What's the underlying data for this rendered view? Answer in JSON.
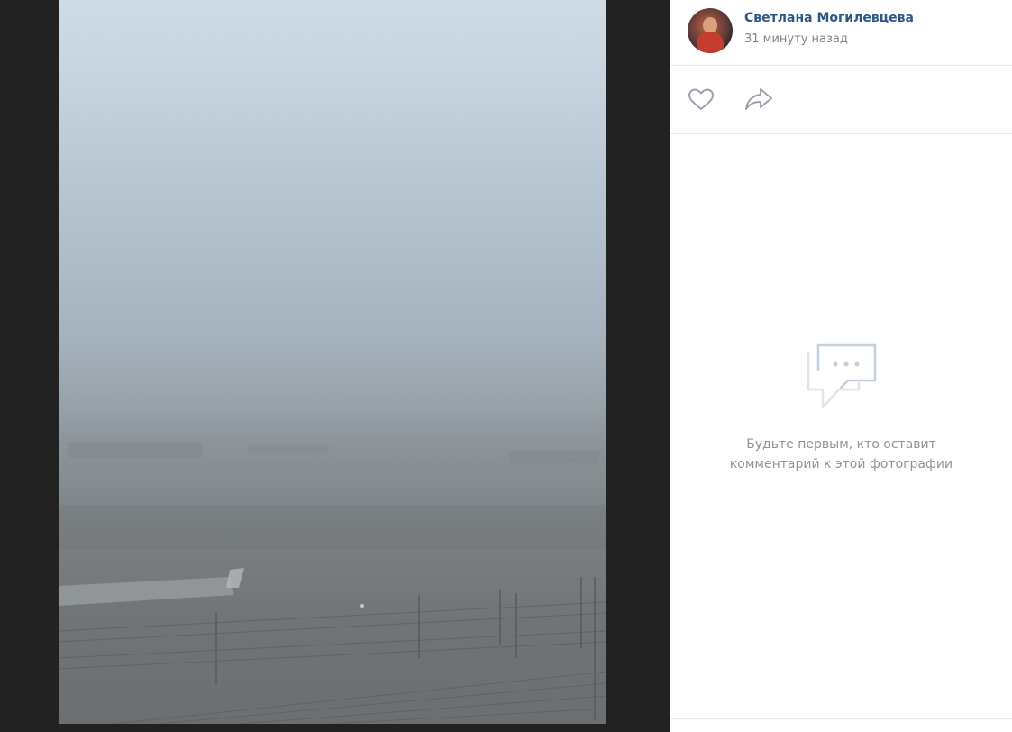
{
  "photo": {
    "description_icon": "foggy-landscape-photo"
  },
  "author": {
    "name": "Светлана Могилевцева",
    "time": "31 минуту назад"
  },
  "actions": {
    "like_icon": "heart-icon",
    "share_icon": "share-arrow-icon"
  },
  "comments": {
    "empty_icon": "comments-bubble-icon",
    "empty_line1": "Будьте первым, кто оставит",
    "empty_line2": "комментарий к этой фотографии"
  },
  "colors": {
    "link": "#2a5885",
    "muted": "#939393",
    "icon": "#99a2ad",
    "background": "#222222"
  }
}
